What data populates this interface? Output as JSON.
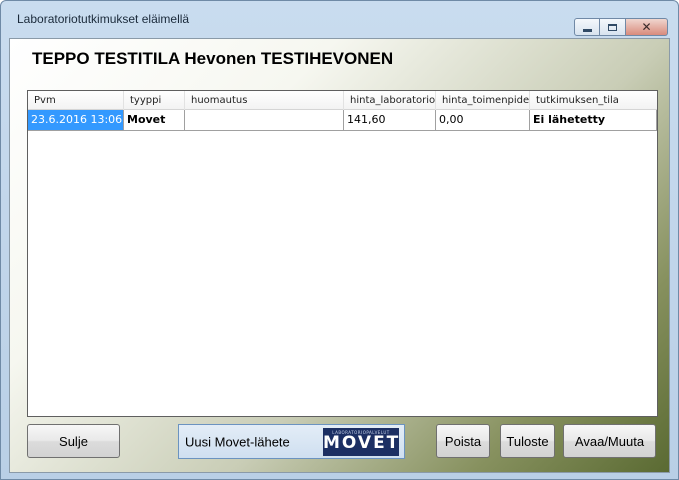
{
  "window": {
    "title": "Laboratoriotutkimukset eläimellä",
    "controls": {
      "minimize": "minimize-icon",
      "maximize": "maximize-icon",
      "close": "close-icon"
    }
  },
  "heading": "TEPPO TESTITILA Hevonen TESTIHEVONEN",
  "grid": {
    "columns": [
      "Pvm",
      "tyyppi",
      "huomautus",
      "hinta_laboratorio",
      "hinta_toimenpide",
      "tutkimuksen_tila"
    ],
    "rows": [
      [
        "23.6.2016 13:06",
        "Movet",
        "",
        "141,60",
        "0,00",
        "Ei lähetetty"
      ]
    ]
  },
  "buttons": {
    "close": "Sulje",
    "new_movet": "Uusi Movet-lähete",
    "delete": "Poista",
    "print": "Tuloste",
    "open_edit": "Avaa/Muuta"
  },
  "logo": {
    "main_text": "MOVET",
    "small_text": "LABORATORIOPALVELUT"
  },
  "colors": {
    "selection": "#3399ff",
    "logo_bg": "#1c2f63",
    "window_frame": "#b9cfe6"
  }
}
